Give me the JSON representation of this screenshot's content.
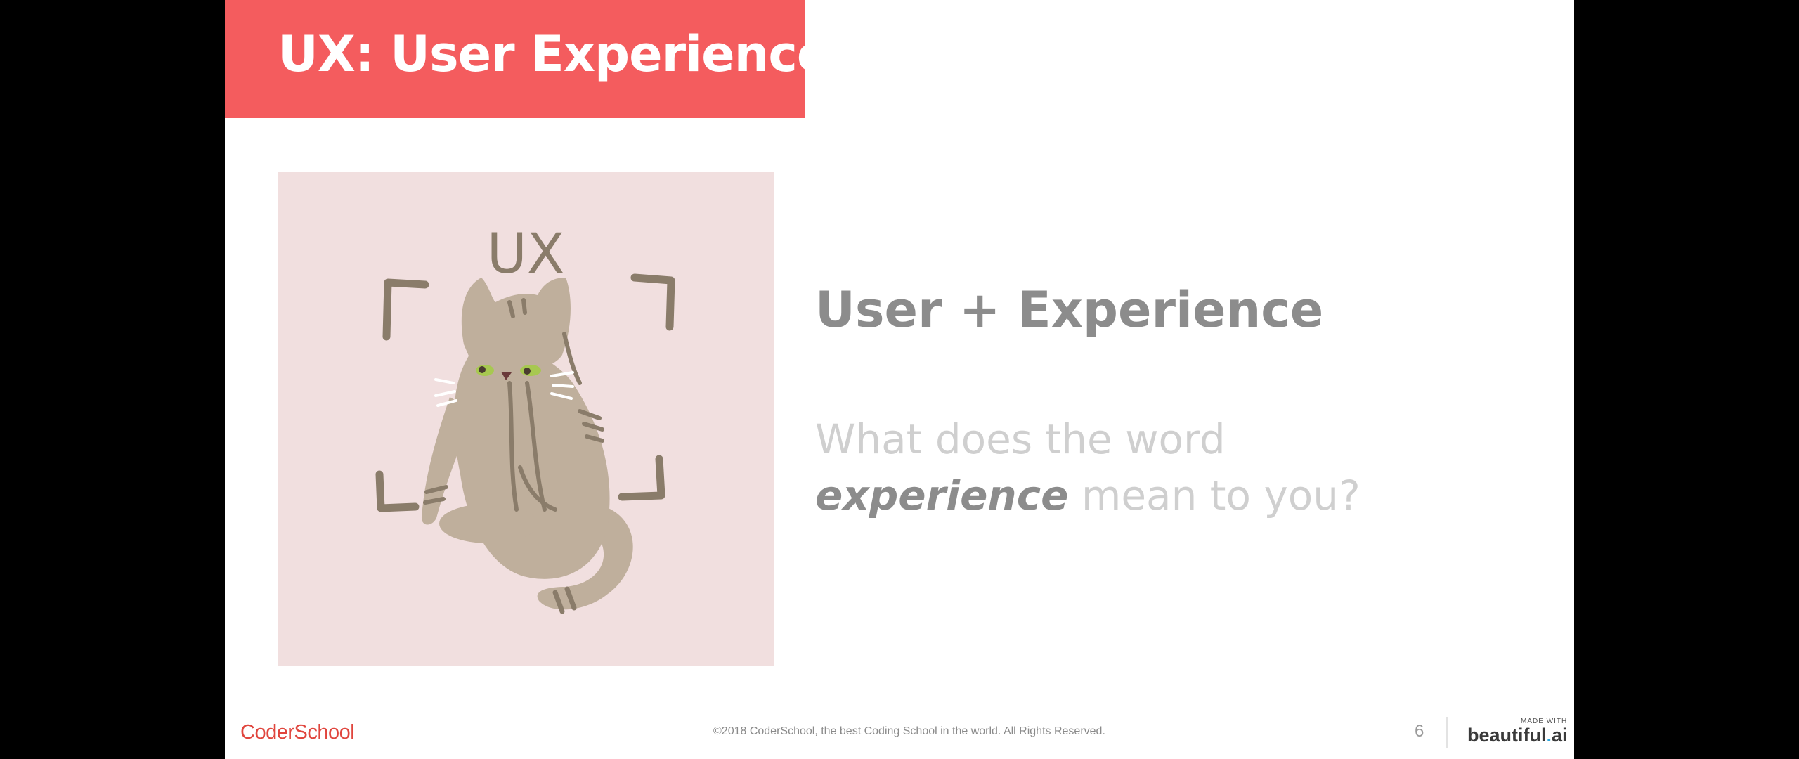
{
  "slide": {
    "title": "UX: User Experience",
    "heading": "User + Experience",
    "question": {
      "before": "What does the word ",
      "emphasis": "experience",
      "after": " mean to you?"
    },
    "illustration": {
      "label": "UX",
      "icon": "cat-illustration-icon"
    }
  },
  "footer": {
    "brand": "CoderSchool",
    "copyright": "©2018 CoderSchool, the best Coding School in the world. All Rights Reserved.",
    "page_number": "6",
    "made_with": "MADE WITH",
    "brand_prefix": "beautiful",
    "brand_dot": ".",
    "brand_suffix": "ai"
  },
  "colors": {
    "title_bar": "#f45c5e",
    "illustration_bg": "#f1dfdf",
    "heading": "#8c8c8c",
    "question": "#cfcfcf",
    "brand_red": "#e0453d"
  }
}
